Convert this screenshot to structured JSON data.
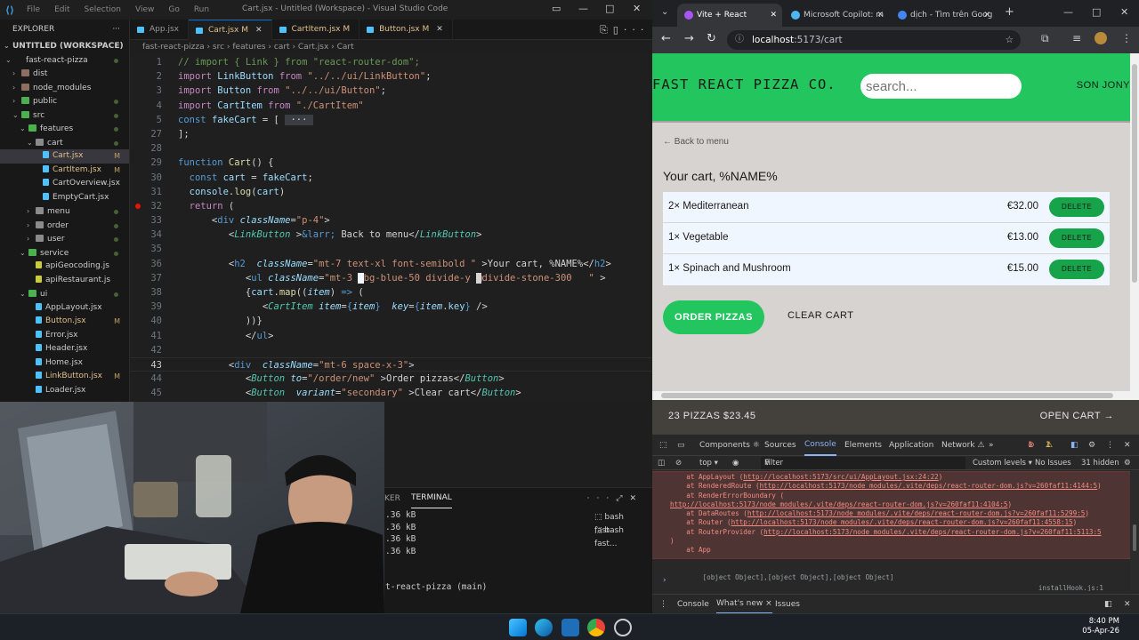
{
  "vscode": {
    "menu": [
      "File",
      "Edit",
      "Selection",
      "View",
      "Go",
      "Run"
    ],
    "window_title": "Cart.jsx - Untitled (Workspace) - Visual Studio Code",
    "explorer_title": "EXPLORER",
    "workspace": "UNTITLED (WORKSPACE)",
    "tree": [
      {
        "label": "fast-react-pizza",
        "indent": 1,
        "chev": "⌄",
        "kind": "root"
      },
      {
        "label": "dist",
        "indent": 2,
        "chev": "›",
        "kind": "folder"
      },
      {
        "label": "node_modules",
        "indent": 2,
        "chev": "›",
        "kind": "folder"
      },
      {
        "label": "public",
        "indent": 2,
        "chev": "›",
        "kind": "folder"
      },
      {
        "label": "src",
        "indent": 2,
        "chev": "⌄",
        "kind": "folder"
      },
      {
        "label": "features",
        "indent": 3,
        "chev": "⌄",
        "kind": "folder"
      },
      {
        "label": "cart",
        "indent": 4,
        "chev": "⌄",
        "kind": "folder"
      },
      {
        "label": "Cart.jsx",
        "indent": 5,
        "chev": "",
        "kind": "file",
        "badge": "M",
        "selected": true
      },
      {
        "label": "CartItem.jsx",
        "indent": 5,
        "chev": "",
        "kind": "file",
        "badge": "M"
      },
      {
        "label": "CartOverview.jsx",
        "indent": 5,
        "chev": "",
        "kind": "file"
      },
      {
        "label": "EmptyCart.jsx",
        "indent": 5,
        "chev": "",
        "kind": "file"
      },
      {
        "label": "menu",
        "indent": 4,
        "chev": "›",
        "kind": "folder"
      },
      {
        "label": "order",
        "indent": 4,
        "chev": "›",
        "kind": "folder"
      },
      {
        "label": "user",
        "indent": 4,
        "chev": "›",
        "kind": "folder"
      },
      {
        "label": "service",
        "indent": 3,
        "chev": "⌄",
        "kind": "folder"
      },
      {
        "label": "apiGeocoding.js",
        "indent": 4,
        "chev": "",
        "kind": "file"
      },
      {
        "label": "apiRestaurant.js",
        "indent": 4,
        "chev": "",
        "kind": "file"
      },
      {
        "label": "ui",
        "indent": 3,
        "chev": "⌄",
        "kind": "folder"
      },
      {
        "label": "AppLayout.jsx",
        "indent": 4,
        "chev": "",
        "kind": "file"
      },
      {
        "label": "Button.jsx",
        "indent": 4,
        "chev": "",
        "kind": "file",
        "badge": "M"
      },
      {
        "label": "Error.jsx",
        "indent": 4,
        "chev": "",
        "kind": "file"
      },
      {
        "label": "Header.jsx",
        "indent": 4,
        "chev": "",
        "kind": "file"
      },
      {
        "label": "Home.jsx",
        "indent": 4,
        "chev": "",
        "kind": "file"
      },
      {
        "label": "LinkButton.jsx",
        "indent": 4,
        "chev": "",
        "kind": "file",
        "badge": "M"
      },
      {
        "label": "Loader.jsx",
        "indent": 4,
        "chev": "",
        "kind": "file"
      }
    ],
    "tabs": [
      {
        "label": "App.jsx",
        "badge": "",
        "active": false
      },
      {
        "label": "Cart.jsx",
        "badge": "M",
        "active": true
      },
      {
        "label": "CartItem.jsx",
        "badge": "M",
        "active": false
      },
      {
        "label": "Button.jsx",
        "badge": "M",
        "active": false
      }
    ],
    "breadcrumb": "fast-react-pizza  ›  src  ›  features  ›  cart  ›  Cart.jsx  ›  Cart",
    "code": [
      {
        "n": "1",
        "html": "<span class='tk-cm'>// import { Link } from \"react-router-dom\";</span>"
      },
      {
        "n": "2",
        "html": "<span class='tk-kw'>import</span> <span class='tk-var'>LinkButton</span> <span class='tk-kw'>from</span> <span class='tk-str'>\"../../ui/LinkButton\"</span>;"
      },
      {
        "n": "3",
        "html": "<span class='tk-kw'>import</span> <span class='tk-var'>Button</span> <span class='tk-kw'>from</span> <span class='tk-str'>\"../../ui/Button\"</span>;"
      },
      {
        "n": "4",
        "html": "<span class='tk-kw'>import</span> <span class='tk-var'>CartItem</span> <span class='tk-kw'>from</span> <span class='tk-str'>\"./CartItem\"</span>"
      },
      {
        "n": "5",
        "html": "<span class='tk-kw2'>const</span> <span class='tk-var'>fakeCart</span> = [ <span style='background:#3a3d41'> ··· </span>"
      },
      {
        "n": "27",
        "html": "];"
      },
      {
        "n": "28",
        "html": ""
      },
      {
        "n": "29",
        "html": "<span class='tk-kw2'>function</span> <span class='tk-fn'>Cart</span>() {"
      },
      {
        "n": "30",
        "html": "  <span class='tk-kw2'>const</span> <span class='tk-var'>cart</span> = <span class='tk-var'>fakeCart</span>;"
      },
      {
        "n": "31",
        "html": "  <span class='tk-var'>console</span>.<span class='tk-fn'>log</span>(<span class='tk-var'>cart</span>)"
      },
      {
        "n": "32",
        "html": "  <span class='tk-kw'>return</span> (",
        "bp": true
      },
      {
        "n": "33",
        "html": "      &lt;<span class='tk-tag'>div</span> <span class='tk-attr'><i>className</i></span>=<span class='tk-str'>\"p-4\"</span>&gt;"
      },
      {
        "n": "34",
        "html": "         &lt;<span class='tk-cmp'><i>LinkButton</i></span> &gt;<span class='tk-kw2'>&amp;larr;</span> Back to menu&lt;/<span class='tk-cmp'><i>LinkButton</i></span>&gt;"
      },
      {
        "n": "35",
        "html": ""
      },
      {
        "n": "36",
        "html": "         &lt;<span class='tk-tag'>h2</span>  <span class='tk-attr'><i>className</i></span>=<span class='tk-str'>\"mt-7 text-xl font-semibold \"</span> &gt;Your cart, %NAME%&lt;/<span class='tk-tag'>h2</span>&gt;"
      },
      {
        "n": "37",
        "html": "            &lt;<span class='tk-tag'>ul</span> <span class='tk-attr'><i>className</i></span>=<span class='tk-str'>\"mt-3 </span><span style='background:#eff6ff;color:#eff6ff'>■</span><span class='tk-str'>bg-blue-50 divide-y </span><span style='background:#d6d3d1;color:#d6d3d1'>■</span><span class='tk-str'>divide-stone-300   \"</span> &gt;"
      },
      {
        "n": "38",
        "html": "            {<span class='tk-var'>cart</span>.<span class='tk-fn'>map</span>((<span class='tk-var'><i>item</i></span>) <span class='tk-kw2'>=&gt;</span> ("
      },
      {
        "n": "39",
        "html": "               &lt;<span class='tk-cmp'><i>CartItem</i></span> <span class='tk-attr'><i>item</i></span>=<span class='tk-kw2'>{</span><span class='tk-var'><i>item</i></span><span class='tk-kw2'>}</span>  <span class='tk-attr'><i>key</i></span>=<span class='tk-kw2'>{</span><span class='tk-var'><i>item</i></span>.<span class='tk-var'>key</span><span class='tk-kw2'>}</span> /&gt;"
      },
      {
        "n": "40",
        "html": "            ))}"
      },
      {
        "n": "41",
        "html": "            &lt;/<span class='tk-tag'>ul</span>&gt;"
      },
      {
        "n": "42",
        "html": ""
      },
      {
        "n": "43",
        "html": "         &lt;<span class='tk-tag'>div</span>  <span class='tk-attr'><i>className</i></span>=<span class='tk-str'>\"mt-6 space-x-3\"</span>&gt;",
        "current": true
      },
      {
        "n": "44",
        "html": "            &lt;<span class='tk-cmp'><i>Button</i></span> <span class='tk-attr'><i>to</i></span>=<span class='tk-str'>\"/order/new\"</span> &gt;Order pizzas&lt;/<span class='tk-cmp'><i>Button</i></span>&gt;"
      },
      {
        "n": "45",
        "html": "            &lt;<span class='tk-cmp'><i>Button</i></span>  <span class='tk-attr'><i>variant</i></span>=<span class='tk-str'>\"secondary\"</span> &gt;Clear cart&lt;/<span class='tk-cmp'><i>Button</i></span>&gt;"
      }
    ],
    "panel": {
      "tab_partial": "KER",
      "tab_terminal": "TERMINAL",
      "lines": [
        ".36 kB",
        ".36 kB",
        ".36 kB",
        ".36 kB",
        "",
        "",
        "t-react-pizza (main)"
      ],
      "terminals": [
        "bash  fast...",
        "bash  fast..."
      ]
    }
  },
  "chrome": {
    "tabs": [
      {
        "label": "Vite + React",
        "active": true,
        "color": "#a855f7"
      },
      {
        "label": "Microsoft Copilot: m",
        "active": false,
        "color": "#4db6f0"
      },
      {
        "label": "dịch - Tìm trên Goog",
        "active": false,
        "color": "#4285f4"
      }
    ],
    "url_host": "localhost",
    "url_path": ":5173/cart",
    "app": {
      "logo": "FAST REACT PIZZA CO.",
      "search_placeholder": "search...",
      "username": "SON JONY",
      "back_link": "← Back to menu",
      "cart_title": "Your cart, %NAME%",
      "items": [
        {
          "name": "2× Mediterranean",
          "price": "€32.00",
          "action": "DELETE"
        },
        {
          "name": "1× Vegetable",
          "price": "€13.00",
          "action": "DELETE"
        },
        {
          "name": "1× Spinach and Mushroom",
          "price": "€15.00",
          "action": "DELETE"
        }
      ],
      "order_button": "ORDER PIZZAS",
      "clear_button": "CLEAR CART",
      "overview_summary": "23 PIZZAS   $23.45",
      "open_cart": "OPEN CART →"
    },
    "devtools": {
      "tabs": [
        "Components ⚛",
        "Sources",
        "Console",
        "Elements",
        "Application",
        "Network ⚠",
        "»"
      ],
      "active_tab": "Console",
      "error_count": "1",
      "warning_count": "1",
      "context": "top ▾",
      "filter_placeholder": "Filter",
      "levels": "Custom levels ▾",
      "issues": "No Issues",
      "hidden": "31 hidden",
      "stack": [
        {
          "pre": "    at AppLayout (",
          "link": "http://localhost:5173/src/ui/AppLayout.jsx:24:22",
          "post": ")"
        },
        {
          "pre": "    at RenderedRoute (",
          "link": "http://localhost:5173/node_modules/.vite/deps/react-router-dom.js?v=260faf11:4144:5",
          "post": ")"
        },
        {
          "pre": "    at RenderErrorBoundary (",
          "link": "",
          "post": ""
        },
        {
          "pre": "",
          "link": "http://localhost:5173/node_modules/.vite/deps/react-router-dom.js?v=260faf11:4104:5",
          "post": ")"
        },
        {
          "pre": "    at DataRoutes (",
          "link": "http://localhost:5173/node_modules/.vite/deps/react-router-dom.js?v=260faf11:5299:5",
          "post": ")"
        },
        {
          "pre": "    at Router (",
          "link": "http://localhost:5173/node_modules/.vite/deps/react-router-dom.js?v=260faf11:4558:15",
          "post": ")"
        },
        {
          "pre": "    at RouterProvider (",
          "link": "http://localhost:5173/node_modules/.vite/deps/react-router-dom.js?v=260faf11:5113:5",
          "post": ""
        },
        {
          "pre": ")",
          "link": "",
          "post": ""
        },
        {
          "pre": "    at App",
          "link": "",
          "post": ""
        }
      ],
      "log": "[object Object],[object Object],[object Object]",
      "log_source": "installHook.js:1",
      "prompt": "›",
      "drawer_tabs": [
        "Console",
        "What's new ×",
        "Issues"
      ]
    }
  },
  "taskbar": {
    "time": "8:40 PM",
    "date": "05-Apr-26"
  }
}
